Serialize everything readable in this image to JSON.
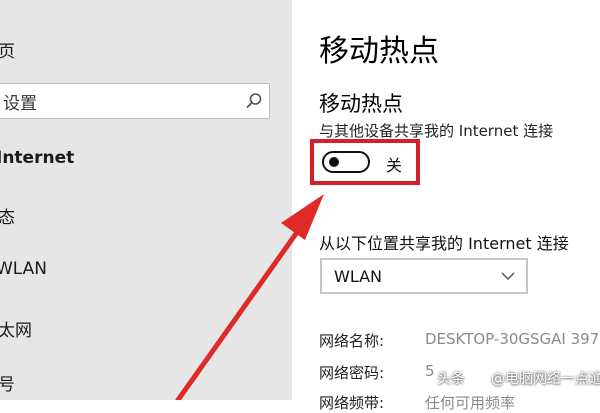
{
  "sidebar": {
    "items": [
      {
        "label": "页"
      },
      {
        "label": "Internet"
      },
      {
        "label": "态"
      },
      {
        "label": "WLAN"
      },
      {
        "label": "太网"
      },
      {
        "label": "号"
      }
    ],
    "search": {
      "value": "设置"
    }
  },
  "main": {
    "title": "移动热点",
    "section_title": "移动热点",
    "section_desc": "与其他设备共享我的 Internet 连接",
    "toggle": {
      "state_label": "关",
      "on": false
    },
    "share_from_label": "从以下位置共享我的 Internet 连接",
    "share_from_select": {
      "value": "WLAN"
    },
    "info": [
      {
        "label": "网络名称:",
        "value": "DESKTOP-30GSGAI 397"
      },
      {
        "label": "网络密码:",
        "value": "5"
      },
      {
        "label": "网络频带:",
        "value": "任何可用频率"
      }
    ]
  },
  "watermark": {
    "prefix": "头条",
    "name": "@电脑网络一点通"
  },
  "colors": {
    "highlight": "#d3202a",
    "arrow": "#e02a2a",
    "sidebar_bg": "#e6e6e6"
  },
  "icons": {
    "search": "search-icon",
    "dropdown": "chevron-down-icon",
    "pointer": "red-arrow"
  }
}
